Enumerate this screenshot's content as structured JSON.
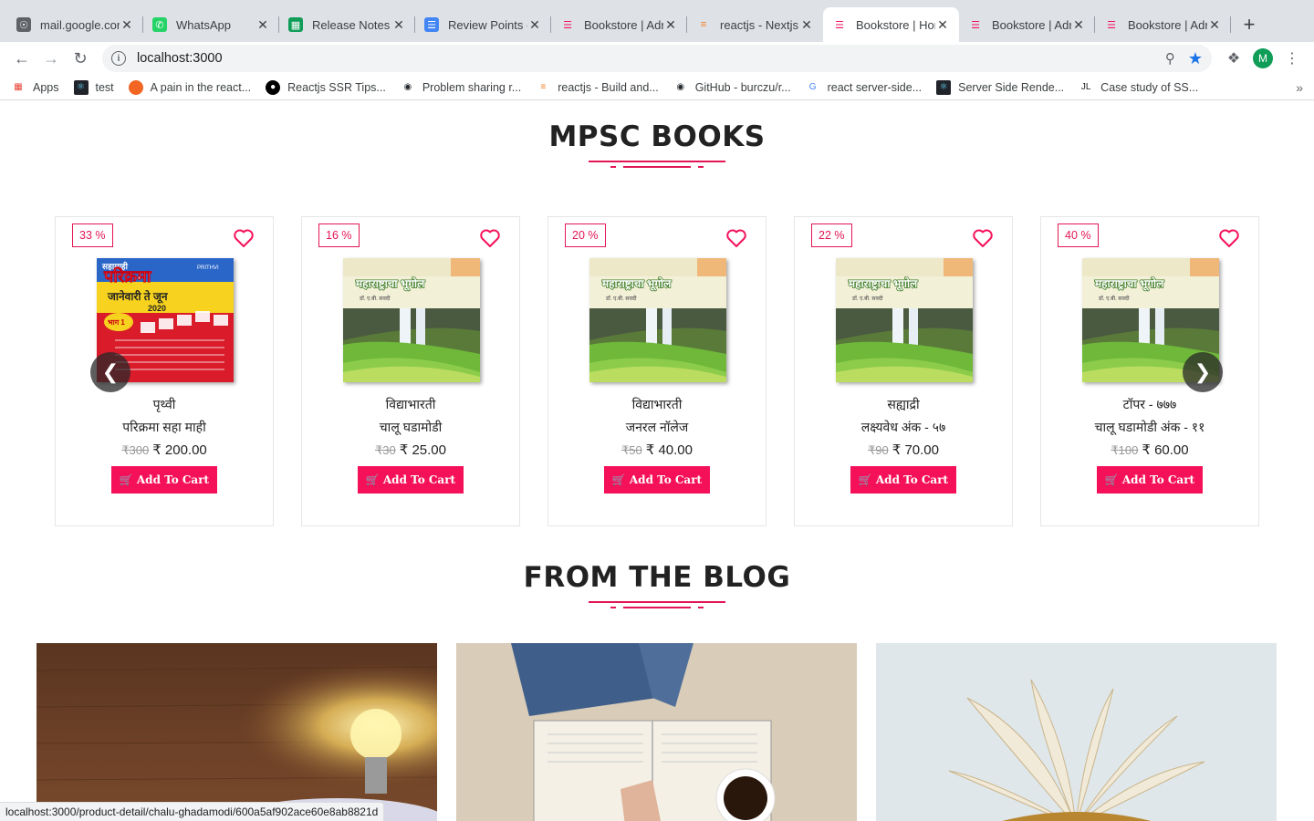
{
  "browser": {
    "tabs": [
      {
        "title": "mail.google.com",
        "icon": "globe-icon"
      },
      {
        "title": "WhatsApp",
        "icon": "whatsapp-icon"
      },
      {
        "title": "Release Notes",
        "icon": "sheets-icon"
      },
      {
        "title": "Review Points -",
        "icon": "docs-icon"
      },
      {
        "title": "Bookstore | Adm",
        "icon": "bookstore-icon"
      },
      {
        "title": "reactjs - Nextjs",
        "icon": "stackoverflow-icon"
      },
      {
        "title": "Bookstore | Hom",
        "icon": "bookstore-icon",
        "active": true
      },
      {
        "title": "Bookstore | Adm",
        "icon": "bookstore-icon"
      },
      {
        "title": "Bookstore | Adm",
        "icon": "bookstore-icon"
      }
    ],
    "new_tab": "+",
    "url": "localhost:3000",
    "profile_initial": "M",
    "bookmarks": [
      {
        "label": "Apps",
        "icon": "apps-grid-icon"
      },
      {
        "label": "test",
        "icon": "react-icon"
      },
      {
        "label": "A pain in the react...",
        "icon": "circle-icon"
      },
      {
        "label": "Reactjs SSR Tips...",
        "icon": "medium-icon"
      },
      {
        "label": "Problem sharing r...",
        "icon": "github-icon"
      },
      {
        "label": "reactjs - Build and...",
        "icon": "stackoverflow-icon"
      },
      {
        "label": "GitHub - burczu/r...",
        "icon": "github-icon"
      },
      {
        "label": "react server-side...",
        "icon": "google-icon"
      },
      {
        "label": "Server Side Rende...",
        "icon": "react-icon"
      },
      {
        "label": "Case study of SS...",
        "icon": "jl-icon"
      }
    ],
    "bookmarks_more": "»",
    "status_url": "localhost:3000/product-detail/chalu-ghadamodi/600a5af902ace60e8ab8821d"
  },
  "colors": {
    "accent": "#f5115a",
    "badge": "#e31655"
  },
  "books_section": {
    "title": "MPSC BOOKS"
  },
  "books": [
    {
      "discount": "33 %",
      "publisher": "पृथ्वी",
      "name": "परिक्रमा सहा माही",
      "mrp": "₹300",
      "price": "₹ 200.00",
      "cta": "Add To Cart",
      "cover": "parikrama"
    },
    {
      "discount": "16 %",
      "publisher": "विद्याभारती",
      "name": "चालू घडामोडी",
      "mrp": "₹30",
      "price": "₹ 25.00",
      "cta": "Add To Cart",
      "cover": "bhugol"
    },
    {
      "discount": "20 %",
      "publisher": "विद्याभारती",
      "name": "जनरल नॉलेज",
      "mrp": "₹50",
      "price": "₹ 40.00",
      "cta": "Add To Cart",
      "cover": "bhugol"
    },
    {
      "discount": "22 %",
      "publisher": "सह्याद्री",
      "name": "लक्ष्यवेध अंक - ५७",
      "mrp": "₹90",
      "price": "₹ 70.00",
      "cta": "Add To Cart",
      "cover": "bhugol"
    },
    {
      "discount": "40 %",
      "publisher": "टॉपर - ७७७",
      "name": "चालू घडामोडी अंक - ११",
      "mrp": "₹100",
      "price": "₹ 60.00",
      "cta": "Add To Cart",
      "cover": "bhugol"
    }
  ],
  "blog_section": {
    "title": "FROM THE BLOG"
  },
  "covers": {
    "parikrama": {
      "top": "सहामाही",
      "title": "परिक्रमा",
      "sub": "जानेवारी ते जून",
      "year": "2020",
      "part": "भाग 1",
      "brand": "PRITHVI"
    },
    "bhugol": {
      "title": "महाराष्ट्राचा भूगोल",
      "author": "डॉ. ए.बी. सवदी"
    }
  }
}
